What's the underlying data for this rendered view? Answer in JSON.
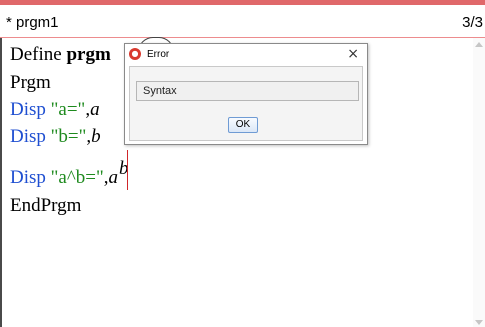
{
  "window": {
    "title": "* prgm1",
    "page_indicator": "3/3"
  },
  "code": {
    "line1_keyword": "Define ",
    "line1_name": "prgm",
    "line2": "Prgm",
    "line3_cmd": "Disp ",
    "line3_str": "\"a=\"",
    "line3_sep": ",",
    "line3_var": "a",
    "line4_cmd": "Disp ",
    "line4_str": "\"b=\"",
    "line4_sep": ",",
    "line4_var": "b",
    "line5_cmd": "Disp ",
    "line5_str": "\"a^b=\"",
    "line5_sep": ",",
    "line5_base": "a",
    "line5_exp": "b",
    "line6": "EndPrgm"
  },
  "dialog": {
    "title": "Error",
    "icon": "error-icon",
    "close_glyph": "×",
    "message": "Syntax",
    "ok_label": "OK"
  },
  "colors": {
    "accent_bar": "#e0686a",
    "keyword_blue": "#1f4fd1",
    "string_green": "#1e8a1e",
    "cursor_red": "#d0262a"
  }
}
